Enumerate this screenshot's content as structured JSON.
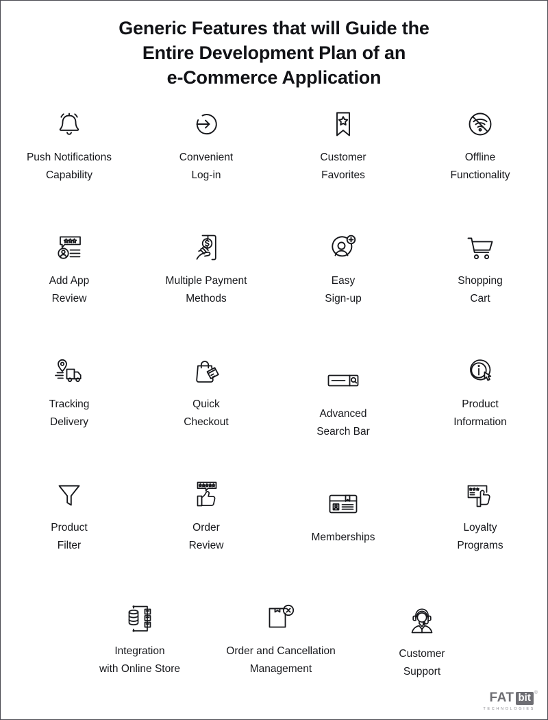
{
  "title": {
    "line1": "Generic Features that will Guide the",
    "line2": "Entire Development Plan of an",
    "line3": "e-Commerce Application"
  },
  "features": [
    {
      "icon": "bell-icon",
      "line1": "Push Notifications",
      "line2": "Capability"
    },
    {
      "icon": "login-arrow-circle-icon",
      "line1": "Convenient",
      "line2": "Log-in"
    },
    {
      "icon": "bookmark-star-icon",
      "line1": "Customer",
      "line2": "Favorites"
    },
    {
      "icon": "wifi-off-icon",
      "line1": "Offline",
      "line2": "Functionality"
    },
    {
      "icon": "app-review-stars-icon",
      "line1": "Add App",
      "line2": "Review"
    },
    {
      "icon": "mobile-payment-hand-icon",
      "line1": "Multiple Payment",
      "line2": "Methods"
    },
    {
      "icon": "user-plus-icon",
      "line1": "Easy",
      "line2": "Sign-up"
    },
    {
      "icon": "shopping-cart-icon",
      "line1": "Shopping",
      "line2": "Cart"
    },
    {
      "icon": "delivery-truck-location-icon",
      "line1": "Tracking",
      "line2": "Delivery"
    },
    {
      "icon": "shopping-bag-card-icon",
      "line1": "Quick",
      "line2": "Checkout"
    },
    {
      "icon": "search-bar-icon",
      "line1": "Advanced",
      "line2": "Search Bar"
    },
    {
      "icon": "info-circle-cursor-icon",
      "line1": "Product",
      "line2": "Information"
    },
    {
      "icon": "funnel-filter-icon",
      "line1": "Product",
      "line2": "Filter"
    },
    {
      "icon": "thumbs-up-rating-icon",
      "line1": "Order",
      "line2": "Review"
    },
    {
      "icon": "membership-card-icon",
      "line1": "Memberships",
      "line2": ""
    },
    {
      "icon": "loyalty-card-hand-icon",
      "line1": "Loyalty",
      "line2": "Programs"
    },
    {
      "icon": "database-integration-icon",
      "line1": "Integration",
      "line2": "with Online Store"
    },
    {
      "icon": "box-cancel-icon",
      "line1": "Order and Cancellation",
      "line2": "Management"
    },
    {
      "icon": "support-agent-headset-icon",
      "line1": "Customer",
      "line2": "Support"
    }
  ],
  "logo": {
    "name_primary": "FAT",
    "name_boxed": "bit",
    "trademark": "®",
    "tagline": "TECHNOLOGIES"
  },
  "colors": {
    "text": "#17181c",
    "title": "#111216",
    "icon_stroke": "#16171b",
    "page_border": "#4a4a52",
    "logo_gray": "#6e6e73",
    "background": "#ffffff"
  }
}
